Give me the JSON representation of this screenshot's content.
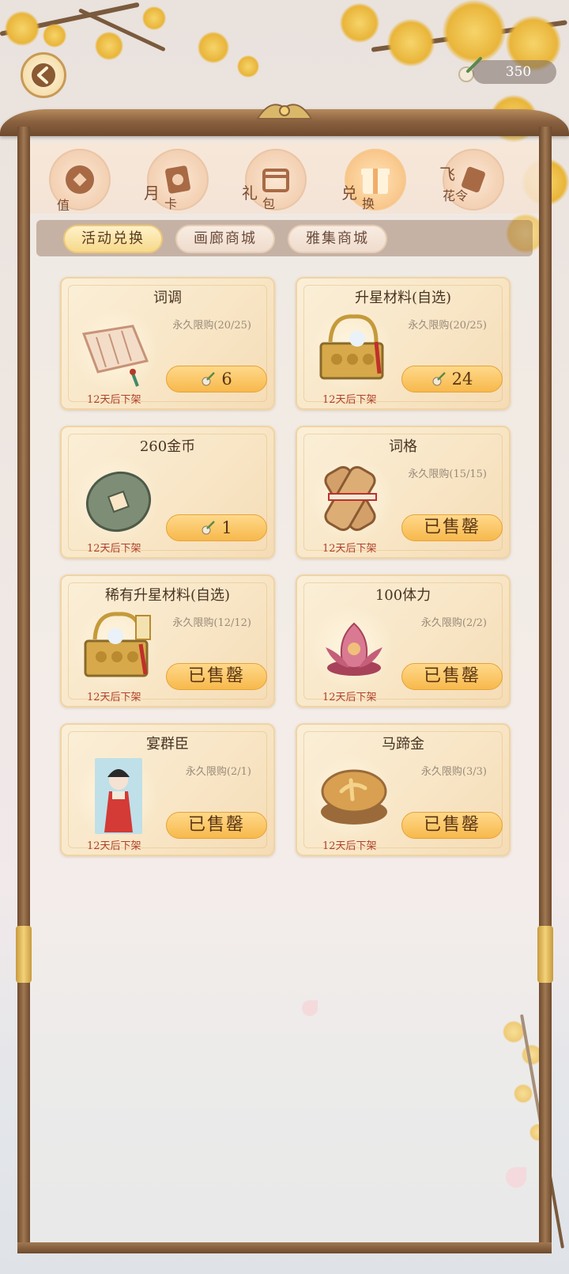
{
  "header": {
    "back_icon": "back-arrow-icon",
    "currency_icon": "brush-token-icon",
    "currency_amount": "350"
  },
  "category_tabs": [
    {
      "name": "recharge",
      "line1": "",
      "line2": "值",
      "icon": "coin-icon",
      "active": false
    },
    {
      "name": "monthly-card",
      "line1": "月",
      "line2": "卡",
      "icon": "card-icon",
      "active": false
    },
    {
      "name": "gift-pack",
      "line1": "礼",
      "line2": "包",
      "icon": "pack-icon",
      "active": false
    },
    {
      "name": "exchange",
      "line1": "兑",
      "line2": "换",
      "icon": "gift-box-icon",
      "active": true
    },
    {
      "name": "feihualing",
      "line1": "飞",
      "line2": "花令",
      "icon": "scroll-icon",
      "active": false
    }
  ],
  "sub_tabs": [
    {
      "label": "活动兑换",
      "active": true
    },
    {
      "label": "画廊商城",
      "active": false
    },
    {
      "label": "雅集商城",
      "active": false
    }
  ],
  "items": [
    {
      "title": "词调",
      "limit": "永久限购(20/25)",
      "expire": "12天后下架",
      "price": "6",
      "sold_out": false,
      "icon": "scroll-icon"
    },
    {
      "title": "升星材料(自选)",
      "limit": "永久限购(20/25)",
      "expire": "12天后下架",
      "price": "24",
      "sold_out": false,
      "icon": "treasure-box-icon"
    },
    {
      "title": "260金币",
      "limit": "",
      "expire": "12天后下架",
      "price": "1",
      "sold_out": false,
      "icon": "coin-icon"
    },
    {
      "title": "词格",
      "limit": "永久限购(15/15)",
      "expire": "12天后下架",
      "price": "已售罄",
      "sold_out": true,
      "icon": "bamboo-slips-icon"
    },
    {
      "title": "稀有升星材料(自选)",
      "limit": "永久限购(12/12)",
      "expire": "12天后下架",
      "price": "已售罄",
      "sold_out": true,
      "icon": "rare-treasure-box-icon"
    },
    {
      "title": "100体力",
      "limit": "永久限购(2/2)",
      "expire": "12天后下架",
      "price": "已售罄",
      "sold_out": true,
      "icon": "lotus-icon"
    },
    {
      "title": "宴群臣",
      "limit": "永久限购(2/1)",
      "expire": "12天后下架",
      "price": "已售罄",
      "sold_out": true,
      "icon": "character-portrait-icon"
    },
    {
      "title": "马蹄金",
      "limit": "永久限购(3/3)",
      "expire": "12天后下架",
      "price": "已售罄",
      "sold_out": true,
      "icon": "gold-ingot-icon"
    }
  ],
  "colors": {
    "frame_wood": "#8b6240",
    "card_bg": "#f8e6c6",
    "button_gold": "#f7b94c",
    "expire_red": "#b0402a",
    "active_tab": "#f9c98e"
  }
}
